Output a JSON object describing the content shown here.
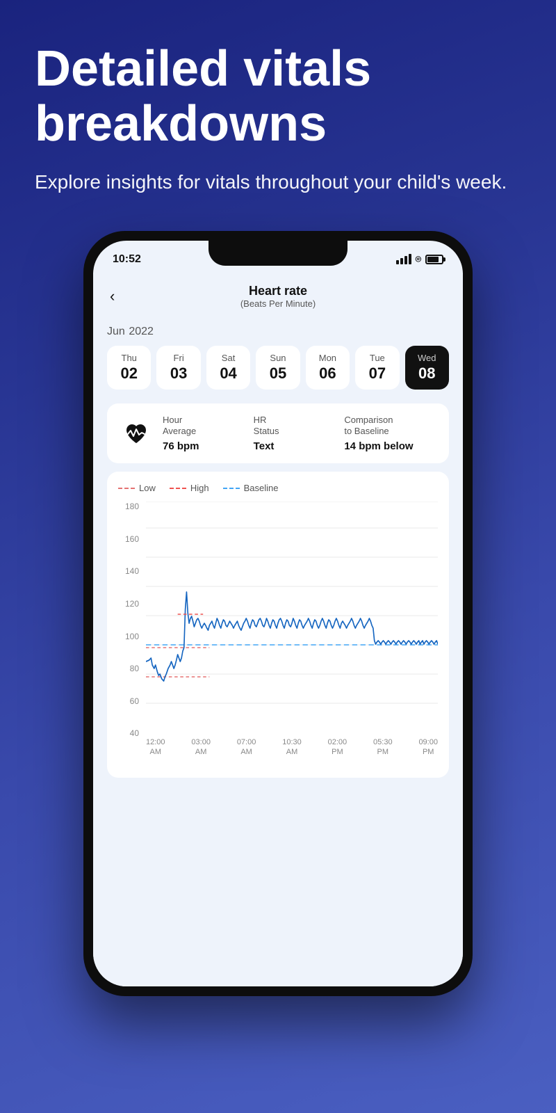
{
  "hero": {
    "title": "Detailed vitals breakdowns",
    "subtitle": "Explore insights for vitals throughout your child's week."
  },
  "status_bar": {
    "time": "10:52",
    "signal_label": "signal",
    "wifi_label": "wifi",
    "battery_label": "battery"
  },
  "header": {
    "back_label": "‹",
    "title": "Heart rate",
    "subtitle": "(Beats Per Minute)"
  },
  "month": {
    "name": "Jun",
    "year": "2022"
  },
  "dates": [
    {
      "day": "Thu",
      "num": "02",
      "active": false
    },
    {
      "day": "Fri",
      "num": "03",
      "active": false
    },
    {
      "day": "Sat",
      "num": "04",
      "active": false
    },
    {
      "day": "Sun",
      "num": "05",
      "active": false
    },
    {
      "day": "Mon",
      "num": "06",
      "active": false
    },
    {
      "day": "Tue",
      "num": "07",
      "active": false
    },
    {
      "day": "Wed",
      "num": "08",
      "active": true
    }
  ],
  "stats": {
    "col1_label": "Hour\nAverage",
    "col1_value": "76 bpm",
    "col2_label": "HR\nStatus",
    "col2_value": "Text",
    "col3_label": "Comparison\nto Baseline",
    "col3_value": "14 bpm below"
  },
  "chart": {
    "legend": {
      "low": "Low",
      "high": "High",
      "baseline": "Baseline"
    },
    "y_labels": [
      "40",
      "60",
      "80",
      "100",
      "120",
      "140",
      "160",
      "180"
    ],
    "x_labels": [
      {
        "line1": "12:00",
        "line2": "AM"
      },
      {
        "line1": "03:00",
        "line2": "AM"
      },
      {
        "line1": "07:00",
        "line2": "AM"
      },
      {
        "line1": "10:30",
        "line2": "AM"
      },
      {
        "line1": "02:00",
        "line2": "PM"
      },
      {
        "line1": "05:30",
        "line2": "PM"
      },
      {
        "line1": "09:00",
        "line2": "PM"
      }
    ]
  },
  "colors": {
    "bg_dark": "#1e2d7d",
    "phone_bg": "#eef3fb",
    "active_pill": "#111111",
    "accent_blue": "#1565c0"
  }
}
